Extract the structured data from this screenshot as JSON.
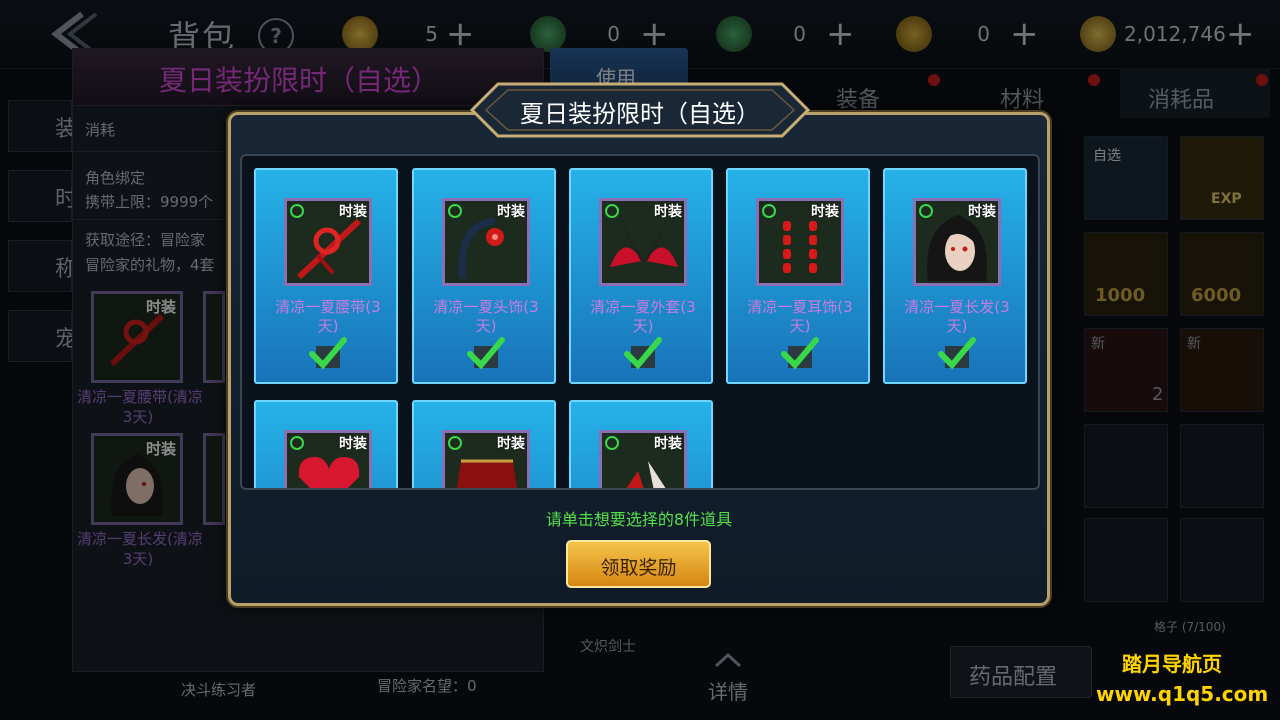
{
  "topbar": {
    "title": "背包",
    "help": "?",
    "currencies": [
      {
        "icon": "medal-icon",
        "value": "5",
        "plus": "+"
      },
      {
        "icon": "green-gem-icon",
        "value": "0",
        "plus": "+"
      },
      {
        "icon": "green-gem-icon",
        "value": "0",
        "plus": "+"
      },
      {
        "icon": "coin-icon",
        "value": "0",
        "plus": "+"
      },
      {
        "icon": "gold-coins-icon",
        "value": "2,012,746",
        "plus": "+"
      }
    ]
  },
  "left_panel": {
    "title": "夏日装扮限时（自选）",
    "type": "消耗",
    "bind": "角色绑定",
    "carry_limit": "携带上限：9999个",
    "source_line1": "获取途径：冒险家",
    "source_line2": "冒险家的礼物，4套",
    "items": [
      {
        "name": "清凉一夏腰带(3天)",
        "name_line1": "清凉一夏腰带(清凉",
        "name_line2": "3天)"
      },
      {
        "name": "清凉一夏长发(3天)",
        "name_line1": "清凉一夏长发(清凉",
        "name_line2": "3天)"
      }
    ],
    "footer_left": "决斗练习者",
    "footer_mid": "冒险家名望：0",
    "side_tabs": [
      "装",
      "时",
      "称",
      "宠"
    ]
  },
  "use_button": "使用",
  "right_panel": {
    "tabs": [
      "装备",
      "材料",
      "消耗品"
    ],
    "badge_zixuan": "自选",
    "badge_exp": "EXP",
    "coin_1000": "1000",
    "coin_6000": "6000",
    "new_badge": "新",
    "count_2": "2",
    "capacity": "格子 (7/100)",
    "class_name": "文炽剑士",
    "detail": "详情",
    "drug_config": "药品配置"
  },
  "dialog": {
    "title": "夏日装扮限时（自选）",
    "item_tag": "时装",
    "items": [
      {
        "name": "清凉一夏腰带(3天)",
        "line1": "清凉一夏腰带(3",
        "line2": "天)",
        "selected": true,
        "icon": "red-belt-icon"
      },
      {
        "name": "清凉一夏头饰(3天)",
        "line1": "清凉一夏头饰(3",
        "line2": "天)",
        "selected": true,
        "icon": "headband-icon"
      },
      {
        "name": "清凉一夏外套(3天)",
        "line1": "清凉一夏外套(3",
        "line2": "天)",
        "selected": true,
        "icon": "bikini-top-icon"
      },
      {
        "name": "清凉一夏耳饰(3天)",
        "line1": "清凉一夏耳饰(3",
        "line2": "天)",
        "selected": true,
        "icon": "earrings-icon"
      },
      {
        "name": "清凉一夏长发(3天)",
        "line1": "清凉一夏长发(3",
        "line2": "天)",
        "selected": true,
        "icon": "long-hair-icon"
      },
      {
        "name": "",
        "selected": false,
        "icon": "red-heart-top-icon"
      },
      {
        "name": "",
        "selected": false,
        "icon": "red-skirt-icon"
      },
      {
        "name": "",
        "selected": false,
        "icon": "red-shoes-icon"
      }
    ],
    "hint": "请单击想要选择的8件道具",
    "claim_button": "领取奖励"
  },
  "watermark": {
    "line1": "踏月导航页",
    "line2": "www.q1q5.com"
  },
  "colors": {
    "accent_gold": "#d68612",
    "card_blue": "#25b2e8",
    "check_green": "#38d84a",
    "hint_green": "#55e04a",
    "item_name_purple": "#c77be0",
    "title_magenta": "#d64ad8"
  }
}
